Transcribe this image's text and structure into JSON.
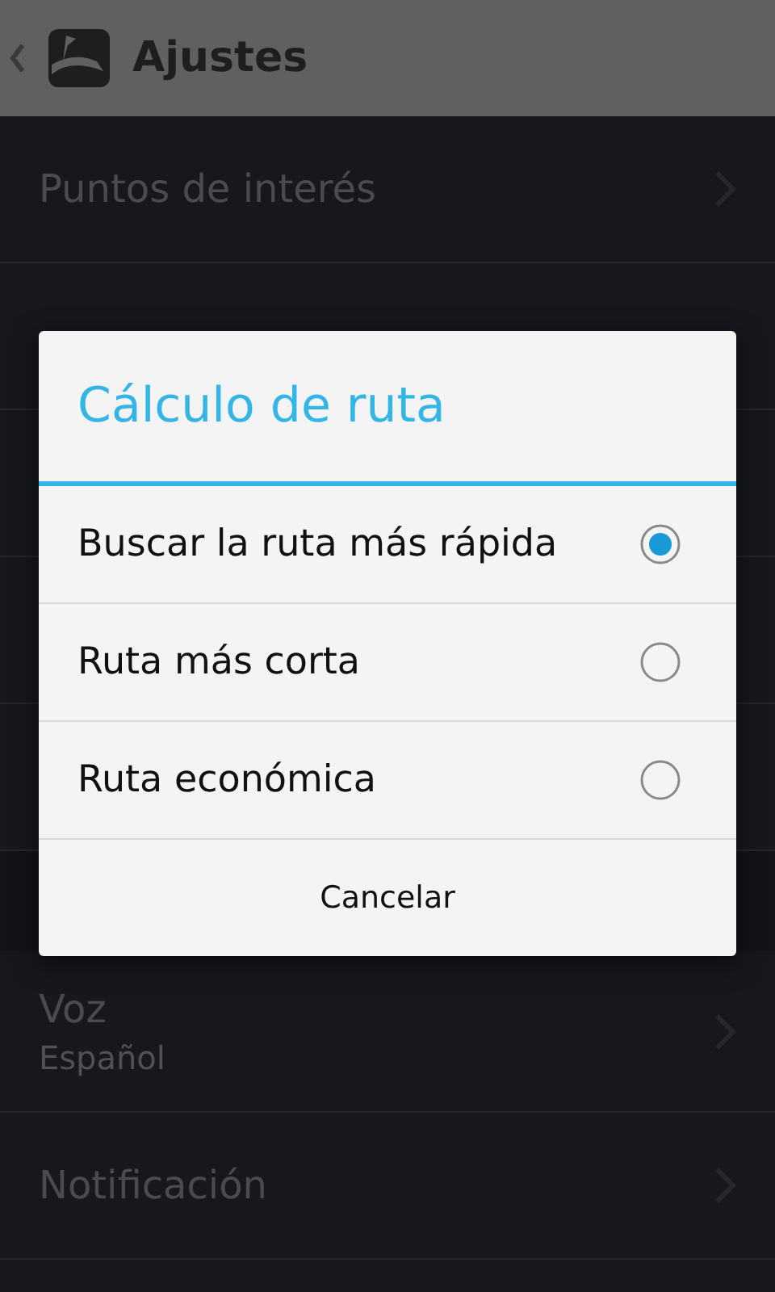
{
  "header": {
    "title": "Ajustes"
  },
  "settings": [
    {
      "title": "Puntos de interés"
    }
  ],
  "voice_settings": [
    {
      "title": "Voz",
      "subtitle": "Español"
    },
    {
      "title": "Notificación"
    }
  ],
  "dialog": {
    "title": "Cálculo de ruta",
    "options": [
      {
        "label": "Buscar la ruta más rápida",
        "selected": true
      },
      {
        "label": "Ruta más corta",
        "selected": false
      },
      {
        "label": "Ruta económica",
        "selected": false
      }
    ],
    "cancel": "Cancelar"
  }
}
